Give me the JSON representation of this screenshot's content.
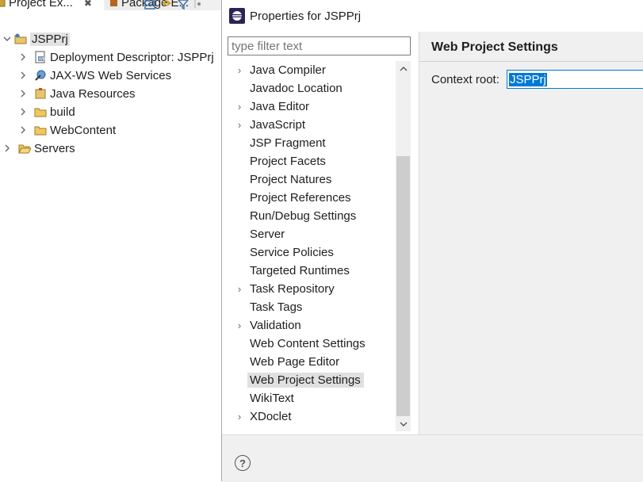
{
  "explorer": {
    "tabs": [
      {
        "label": "Project Ex...",
        "close": "✖"
      },
      {
        "label": "Package E..."
      }
    ],
    "tree": [
      {
        "label": "JSPPrj",
        "chevron": "⌄",
        "icon": "project-icon",
        "selected": true
      },
      {
        "label": "Deployment Descriptor: JSPPrj",
        "chevron": "›",
        "icon": "deployment-descriptor-icon"
      },
      {
        "label": "JAX-WS Web Services",
        "chevron": "›",
        "icon": "web-services-icon"
      },
      {
        "label": "Java Resources",
        "chevron": "›",
        "icon": "java-resources-icon"
      },
      {
        "label": "build",
        "chevron": "›",
        "icon": "folder-icon"
      },
      {
        "label": "WebContent",
        "chevron": "›",
        "icon": "folder-icon"
      },
      {
        "label": "Servers",
        "chevron": "›",
        "icon": "folder-open-icon"
      }
    ]
  },
  "dialog": {
    "title": "Properties for JSPPrj",
    "filter_placeholder": "type filter text",
    "nav_items": [
      {
        "label": "Java Compiler",
        "expandable": true
      },
      {
        "label": "Javadoc Location",
        "expandable": false
      },
      {
        "label": "Java Editor",
        "expandable": true
      },
      {
        "label": "JavaScript",
        "expandable": true
      },
      {
        "label": "JSP Fragment",
        "expandable": false
      },
      {
        "label": "Project Facets",
        "expandable": false
      },
      {
        "label": "Project Natures",
        "expandable": false
      },
      {
        "label": "Project References",
        "expandable": false
      },
      {
        "label": "Run/Debug Settings",
        "expandable": false
      },
      {
        "label": "Server",
        "expandable": false
      },
      {
        "label": "Service Policies",
        "expandable": false
      },
      {
        "label": "Targeted Runtimes",
        "expandable": false
      },
      {
        "label": "Task Repository",
        "expandable": true
      },
      {
        "label": "Task Tags",
        "expandable": false
      },
      {
        "label": "Validation",
        "expandable": true
      },
      {
        "label": "Web Content Settings",
        "expandable": false
      },
      {
        "label": "Web Page Editor",
        "expandable": false
      },
      {
        "label": "Web Project Settings",
        "expandable": false,
        "selected": true
      },
      {
        "label": "WikiText",
        "expandable": false
      },
      {
        "label": "XDoclet",
        "expandable": true
      }
    ],
    "page": {
      "title": "Web Project Settings",
      "context_root_label": "Context root:",
      "context_root_value": "JSPPrj"
    },
    "help_label": "?"
  },
  "colors": {
    "selection_blue": "#0078d7",
    "dialog_bg": "#f0f0f0",
    "nav_selected": "#e0e0e0"
  }
}
